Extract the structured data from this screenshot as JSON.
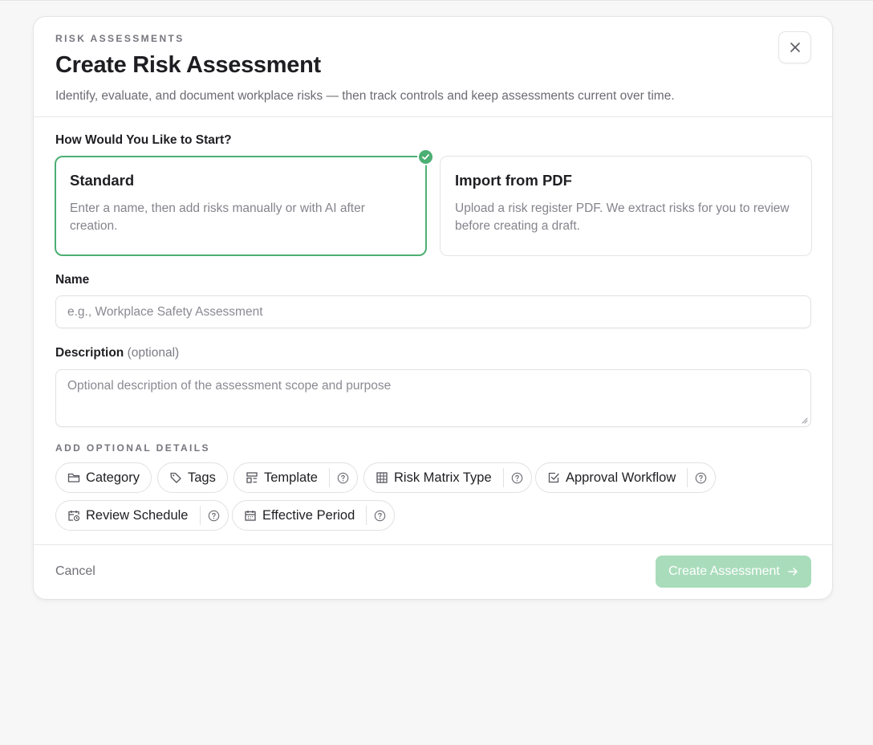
{
  "header": {
    "eyebrow": "RISK ASSESSMENTS",
    "title": "Create Risk Assessment",
    "subtitle": "Identify, evaluate, and document workplace risks — then track controls and keep assessments current over time."
  },
  "start": {
    "label": "How Would You Like to Start?",
    "options": [
      {
        "title": "Standard",
        "description": "Enter a name, then add risks manually or with AI after creation.",
        "selected": true
      },
      {
        "title": "Import from PDF",
        "description": "Upload a risk register PDF. We extract risks for you to review before creating a draft.",
        "selected": false
      }
    ]
  },
  "name": {
    "label": "Name",
    "placeholder": "e.g., Workplace Safety Assessment"
  },
  "description": {
    "label": "Description",
    "optional": "(optional)",
    "placeholder": "Optional description of the assessment scope and purpose"
  },
  "optional_details": {
    "label": "ADD OPTIONAL DETAILS",
    "chips": [
      {
        "label": "Category",
        "icon": "folder-icon",
        "help": false
      },
      {
        "label": "Tags",
        "icon": "tag-icon",
        "help": false
      },
      {
        "label": "Template",
        "icon": "template-icon",
        "help": true
      },
      {
        "label": "Risk Matrix Type",
        "icon": "grid-icon",
        "help": true
      },
      {
        "label": "Approval Workflow",
        "icon": "checkbox-icon",
        "help": true
      },
      {
        "label": "Review Schedule",
        "icon": "calendar-clock-icon",
        "help": true
      },
      {
        "label": "Effective Period",
        "icon": "calendar-icon",
        "help": true
      }
    ]
  },
  "footer": {
    "cancel": "Cancel",
    "submit": "Create Assessment"
  },
  "colors": {
    "accent": "#4caf73",
    "submit_disabled": "#a9dcbb"
  }
}
